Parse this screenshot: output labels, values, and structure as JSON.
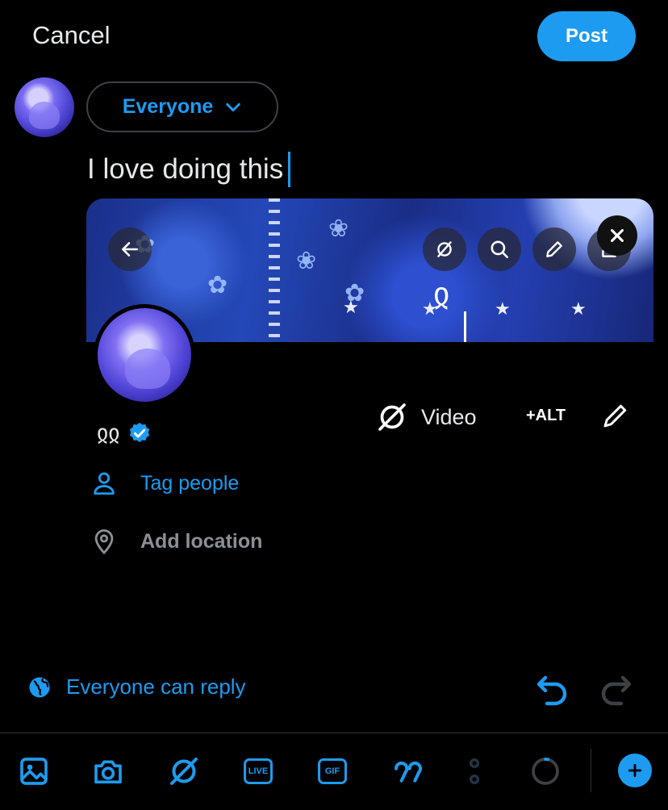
{
  "header": {
    "cancel_label": "Cancel",
    "post_label": "Post"
  },
  "audience": {
    "label": "Everyone"
  },
  "composer": {
    "text": "I love doing this"
  },
  "media_toolbar": {
    "video_label": "Video",
    "alt_label": "+ALT"
  },
  "profile": {
    "handle": "ჲჲ"
  },
  "meta": {
    "tag_people": "Tag people",
    "add_location": "Add location"
  },
  "reply": {
    "label": "Everyone can reply"
  },
  "colors": {
    "accent": "#1d9bf0",
    "background": "#000000",
    "text": "#e7e9ea",
    "muted": "#8b8f94"
  },
  "icons": [
    "image-icon",
    "camera-icon",
    "no-video-icon",
    "live-icon",
    "gif-icon",
    "quote-icon",
    "poll-icon",
    "progress-ring-icon",
    "add-icon"
  ]
}
